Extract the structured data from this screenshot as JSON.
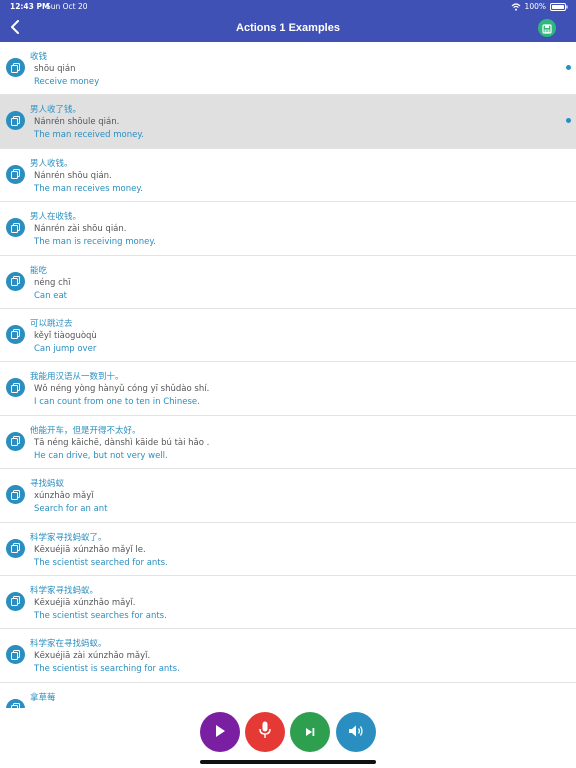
{
  "status": {
    "time": "12:43 PM",
    "date": "Sun Oct 20",
    "battery": "100%"
  },
  "header": {
    "title": "Actions 1 Examples",
    "back_icon": "chevron-left-icon",
    "save_icon": "save-icon"
  },
  "colors": {
    "header": "#3f51b5",
    "accent": "#2a8fc0",
    "play": "#7b1fa2",
    "record": "#e53935",
    "next": "#2e9e4f",
    "speaker": "#2a8fc0",
    "save": "#2fb87d"
  },
  "items": [
    {
      "hanzi": "收钱",
      "pinyin": "shōu qián",
      "english": "Receive money",
      "dot": true,
      "selected": false
    },
    {
      "hanzi": "男人收了钱。",
      "pinyin": "Nánrén shōule qián.",
      "english": "The man received money.",
      "dot": true,
      "selected": true
    },
    {
      "hanzi": "男人收钱。",
      "pinyin": "Nánrén shōu qián.",
      "english": "The man receives money.",
      "dot": false,
      "selected": false
    },
    {
      "hanzi": "男人在收钱。",
      "pinyin": "Nánrén zài shōu qián.",
      "english": "The man is receiving money.",
      "dot": false,
      "selected": false
    },
    {
      "hanzi": "能吃",
      "pinyin": "néng chī",
      "english": "Can eat",
      "dot": false,
      "selected": false
    },
    {
      "hanzi": "可以跳过去",
      "pinyin": "kěyǐ tiàoguòqù",
      "english": "Can jump over",
      "dot": false,
      "selected": false
    },
    {
      "hanzi": "我能用汉语从一数到十。",
      "pinyin": "Wǒ néng yòng hànyǔ cóng yī shǔdào shí.",
      "english": "I can count from one to ten in Chinese.",
      "dot": false,
      "selected": false
    },
    {
      "hanzi": "他能开车，但是开得不太好。",
      "pinyin": "Tā néng kāichē, dànshì kāide bú tài hǎo .",
      "english": "He can drive, but not very well.",
      "dot": false,
      "selected": false
    },
    {
      "hanzi": "寻找蚂蚁",
      "pinyin": "xúnzhǎo mǎyǐ",
      "english": "Search for an ant",
      "dot": false,
      "selected": false
    },
    {
      "hanzi": "科学家寻找蚂蚁了。",
      "pinyin": "Kēxuéjiā xúnzhǎo mǎyǐ le.",
      "english": "The scientist searched for ants.",
      "dot": false,
      "selected": false
    },
    {
      "hanzi": "科学家寻找蚂蚁。",
      "pinyin": "Kēxuéjiā xúnzhǎo mǎyǐ.",
      "english": "The scientist searches for ants.",
      "dot": false,
      "selected": false
    },
    {
      "hanzi": "科学家在寻找蚂蚁。",
      "pinyin": "Kēxuéjiā zài xúnzhǎo mǎyǐ.",
      "english": "The scientist is searching for ants.",
      "dot": false,
      "selected": false
    },
    {
      "hanzi": "拿草莓",
      "pinyin": "",
      "english": "",
      "dot": false,
      "selected": false
    }
  ],
  "controls": [
    {
      "name": "play-button",
      "icon": "play-icon"
    },
    {
      "name": "record-button",
      "icon": "microphone-icon"
    },
    {
      "name": "next-button",
      "icon": "skip-next-icon"
    },
    {
      "name": "speaker-button",
      "icon": "speaker-icon"
    }
  ]
}
